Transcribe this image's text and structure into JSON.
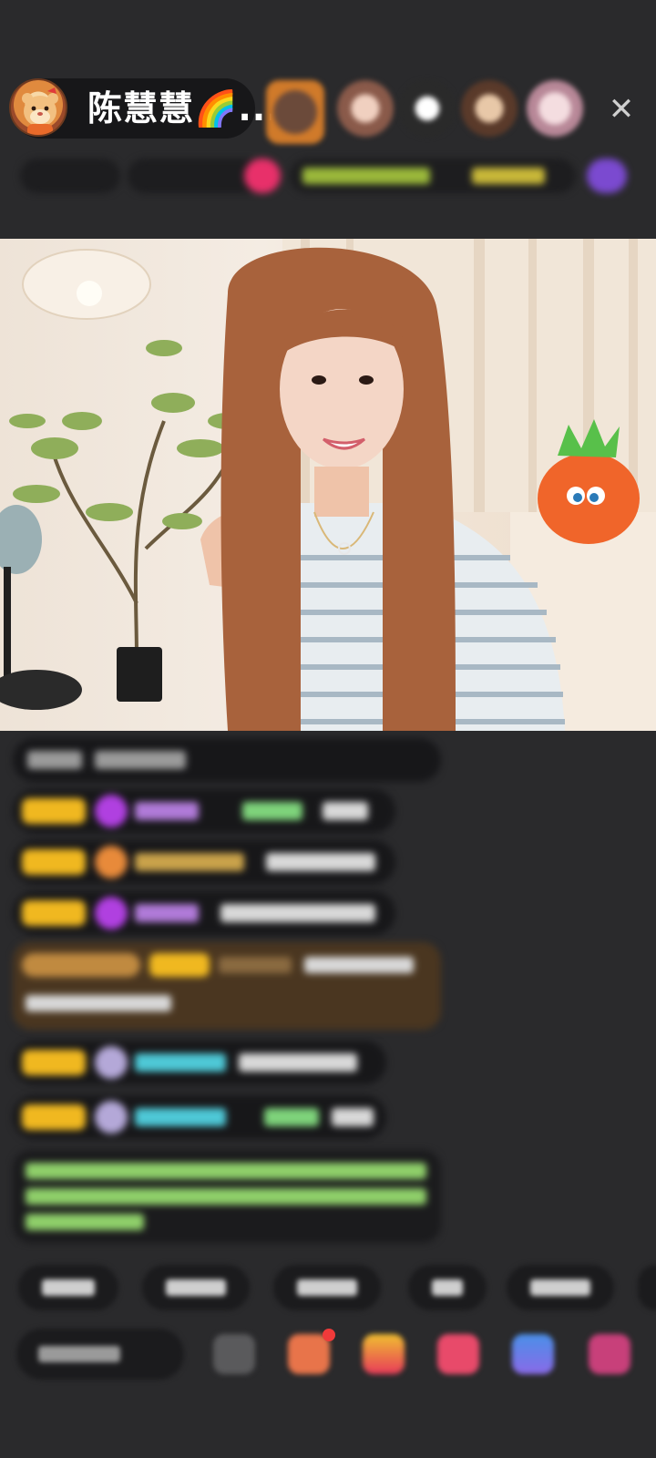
{
  "host": {
    "name": "陈慧慧🌈...",
    "avatar_icon": "cartoon-hamster-avatar"
  },
  "top_viewers": [
    "viewer-avatar-1",
    "viewer-avatar-2",
    "viewer-avatar-3",
    "viewer-avatar-4",
    "viewer-avatar-5"
  ],
  "header": {
    "close_glyph": "✕"
  },
  "stream": {
    "description_icon": "live-video-frame"
  },
  "colors": {
    "background": "#2a2a2c",
    "badge_gold": "#f0b820",
    "name_purple": "#b07ad8",
    "name_gold": "#c9a24a",
    "name_cyan": "#4ec8d6",
    "name_green": "#7ed37b"
  }
}
